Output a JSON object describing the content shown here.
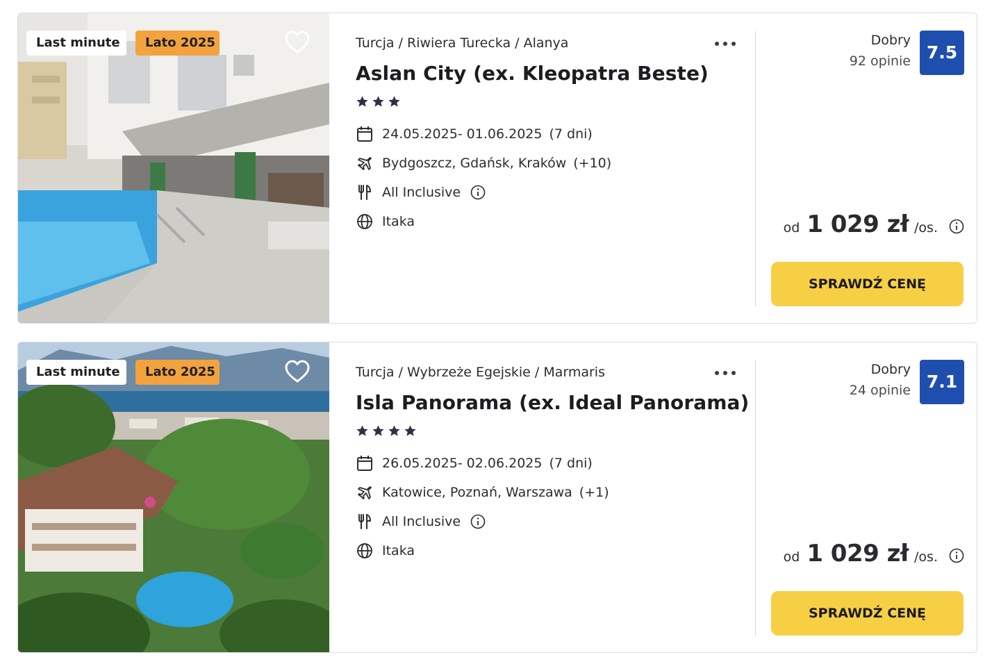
{
  "colors": {
    "score_bg": "#1f4fae",
    "cta_bg": "#f7cf45",
    "season_badge_bg": "#f3a23d",
    "text": "#1f2024"
  },
  "offers": [
    {
      "badges": {
        "last_minute": "Last minute",
        "season": "Lato 2025"
      },
      "photo": "hotel-pool-photo",
      "breadcrumb": "Turcja / Riwiera Turecka / Alanya",
      "name": "Aslan City (ex. Kleopatra Beste)",
      "stars": 3,
      "dates": "24.05.2025- 01.06.2025",
      "duration": "(7 dni)",
      "departures": "Bydgoszcz, Gdańsk, Kraków",
      "departures_more": "(+10)",
      "board": "All Inclusive",
      "operator": "Itaka",
      "rating_label": "Dobry",
      "rating_count": "92 opinie",
      "score": "7.5",
      "price_prefix": "od",
      "price": "1 029 zł",
      "price_unit": "/os.",
      "cta": "SPRAWDŹ CENĘ"
    },
    {
      "badges": {
        "last_minute": "Last minute",
        "season": "Lato 2025"
      },
      "photo": "resort-bay-photo",
      "breadcrumb": "Turcja / Wybrzeże Egejskie / Marmaris",
      "name": "Isla Panorama (ex. Ideal Panorama)",
      "stars": 4,
      "dates": "26.05.2025- 02.06.2025",
      "duration": "(7 dni)",
      "departures": "Katowice, Poznań, Warszawa",
      "departures_more": "(+1)",
      "board": "All Inclusive",
      "operator": "Itaka",
      "rating_label": "Dobry",
      "rating_count": "24 opinie",
      "score": "7.1",
      "price_prefix": "od",
      "price": "1 029 zł",
      "price_unit": "/os.",
      "cta": "SPRAWDŹ CENĘ"
    }
  ]
}
